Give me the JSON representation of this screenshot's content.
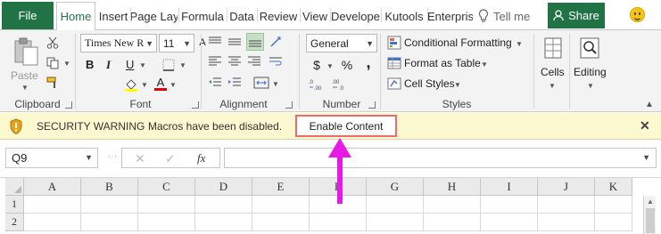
{
  "tabs": {
    "file": "File",
    "home": "Home",
    "insert": "Insert",
    "page_layout": "Page Lay",
    "formulas": "Formula",
    "data": "Data",
    "review": "Review",
    "view": "View",
    "developer": "Develope",
    "kutools": "Kutools",
    "enterprise": "Enterpris",
    "tell_me": "Tell me",
    "share": "Share"
  },
  "ribbon": {
    "clipboard": {
      "paste": "Paste",
      "label": "Clipboard"
    },
    "font": {
      "name": "Times New R",
      "size": "11",
      "bold": "B",
      "italic": "I",
      "underline": "U",
      "label": "Font",
      "fill_color": "#ffff00",
      "font_color": "#e00000"
    },
    "alignment": {
      "label": "Alignment"
    },
    "number": {
      "format": "General",
      "currency": "$",
      "percent": "%",
      "comma": ",",
      "label": "Number"
    },
    "styles": {
      "conditional": "Conditional Formatting",
      "format_table": "Format as Table",
      "cell_styles": "Cell Styles",
      "label": "Styles"
    },
    "cells": {
      "label": "Cells"
    },
    "editing": {
      "label": "Editing"
    }
  },
  "security_bar": {
    "title": "SECURITY WARNING",
    "message": "Macros have been disabled.",
    "enable_button": "Enable Content",
    "close": "✕"
  },
  "formula_bar": {
    "name_box": "Q9",
    "fx": "fx",
    "value": ""
  },
  "grid": {
    "columns": [
      "A",
      "B",
      "C",
      "D",
      "E",
      "F",
      "G",
      "H",
      "I",
      "J",
      "K"
    ],
    "rows": [
      "1",
      "2"
    ]
  },
  "colors": {
    "excel_green": "#217346",
    "warning_bg": "#fcf8d0",
    "highlight_border": "#f06a6a",
    "annotation": "#e619e6"
  }
}
